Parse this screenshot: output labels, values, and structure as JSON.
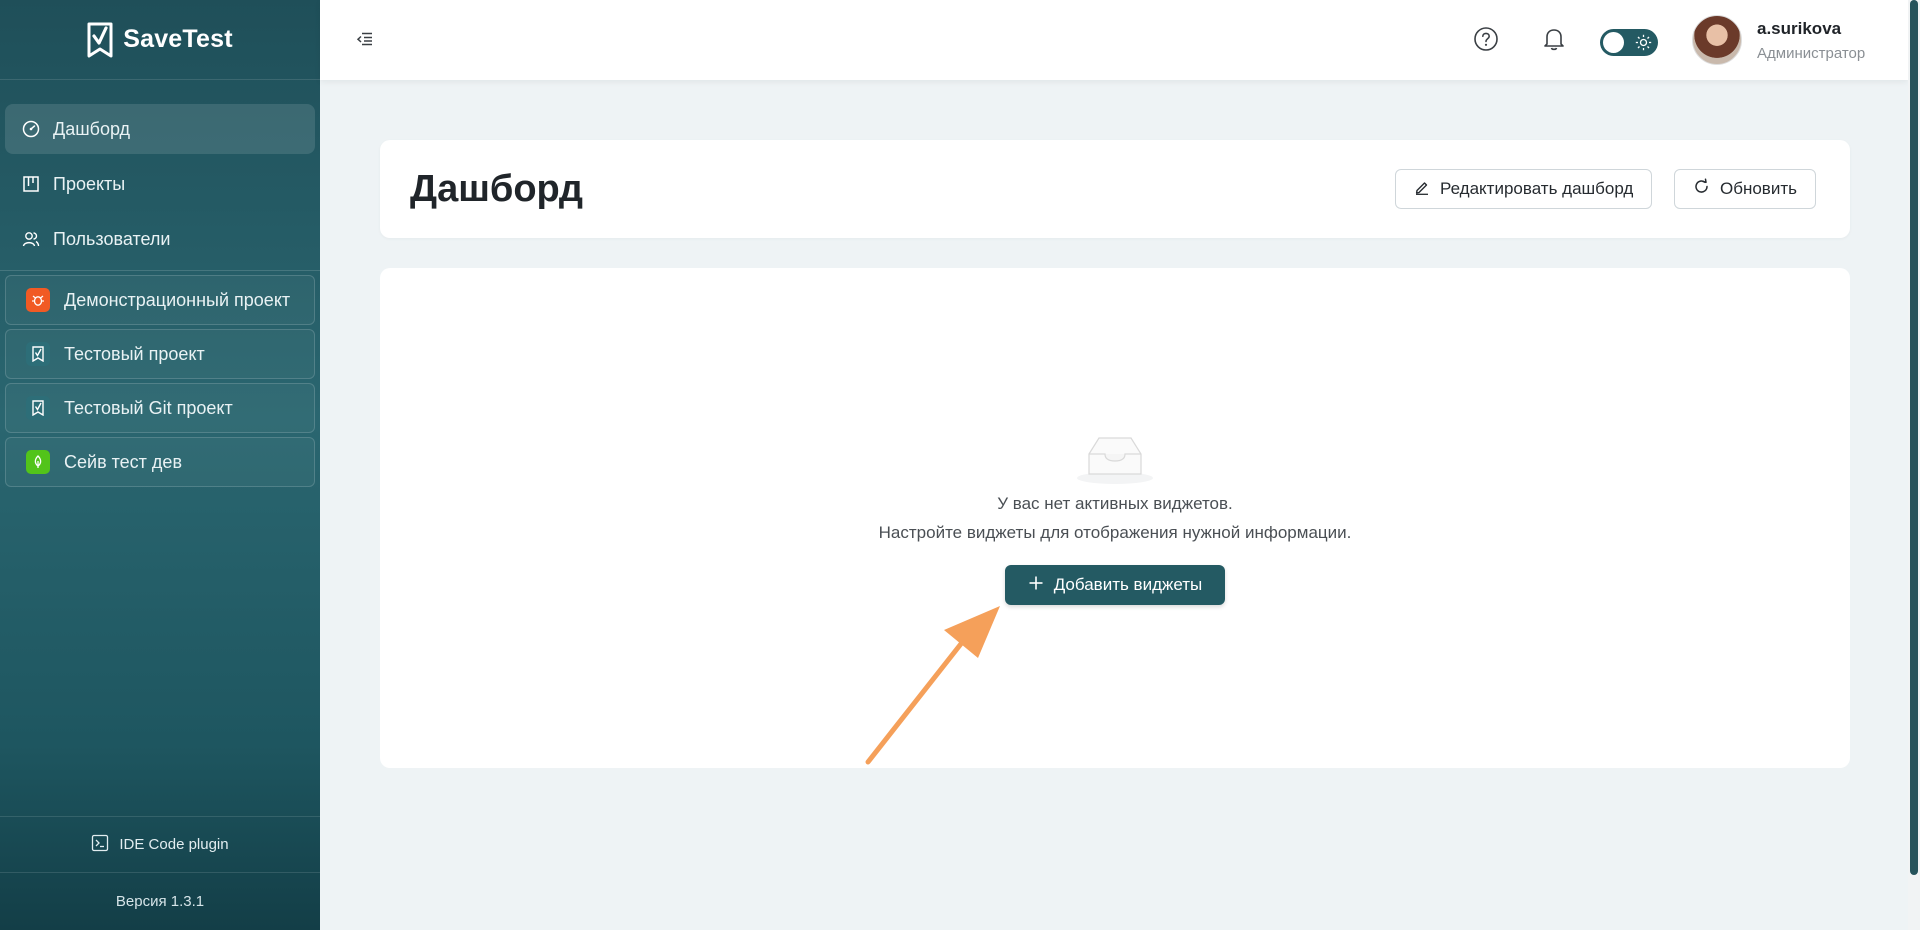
{
  "app": {
    "name": "SaveTest"
  },
  "sidebar": {
    "nav": [
      {
        "label": "Дашборд",
        "icon": "dashboard-gauge-icon",
        "active": true
      },
      {
        "label": "Проекты",
        "icon": "kanban-board-icon"
      },
      {
        "label": "Пользователи",
        "icon": "users-icon"
      }
    ],
    "projects": [
      {
        "label": "Демонстрационный проект",
        "icon": "bug-icon",
        "color": "#f15a24"
      },
      {
        "label": "Тестовый проект",
        "icon": "savetest-logo-icon",
        "color": "#2d6e78"
      },
      {
        "label": "Тестовый Git проект",
        "icon": "savetest-logo-icon",
        "color": "#2d6e78"
      },
      {
        "label": "Сейв тест дев",
        "icon": "leaf-icon",
        "color": "#52c41a"
      }
    ],
    "ide_plugin": "IDE Code plugin",
    "version": "Версия 1.3.1"
  },
  "header": {
    "user": {
      "name": "a.surikova",
      "role": "Администратор"
    }
  },
  "main": {
    "title": "Дашборд",
    "edit_button": "Редактировать дашборд",
    "refresh_button": "Обновить",
    "empty": {
      "line1": "У вас нет активных виджетов.",
      "line2": "Настройте виджеты для отображения нужной информации.",
      "add_button": "Добавить виджеты"
    }
  },
  "colors": {
    "accent": "#245a63",
    "annotation_arrow": "#f5a05a"
  }
}
